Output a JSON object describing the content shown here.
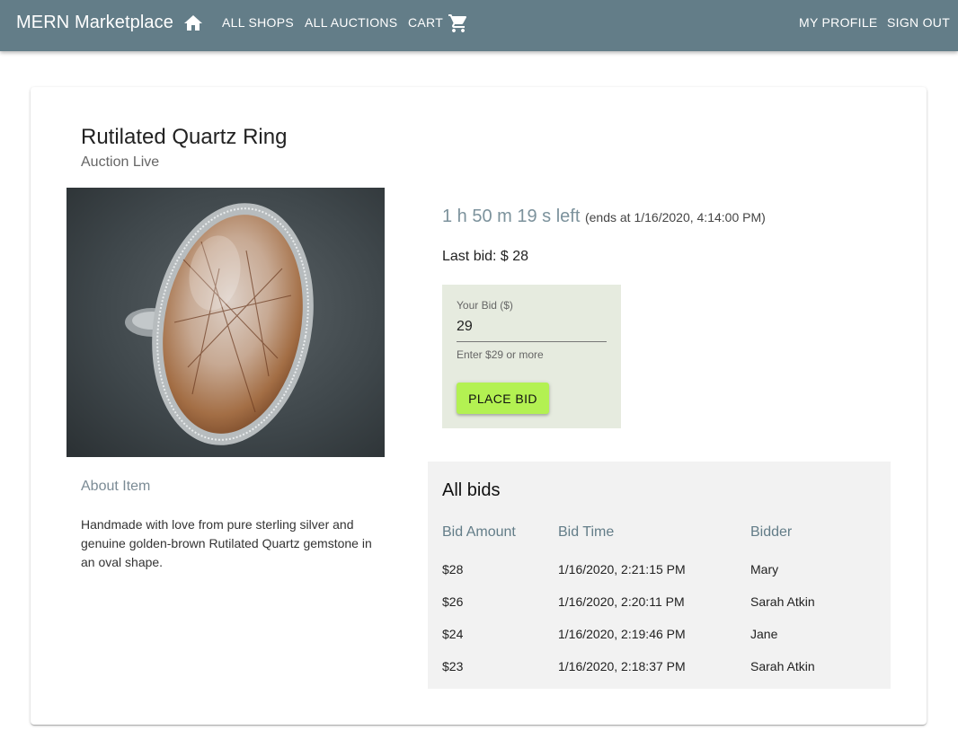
{
  "appbar": {
    "brand": "MERN Marketplace",
    "nav": {
      "all_shops": "ALL SHOPS",
      "all_auctions": "ALL AUCTIONS",
      "cart": "CART",
      "my_profile": "MY PROFILE",
      "sign_out": "SIGN OUT"
    },
    "icons": {
      "home": "home-icon",
      "cart": "shopping-cart-icon"
    },
    "color": "#637d88"
  },
  "auction": {
    "title": "Rutilated Quartz Ring",
    "status": "Auction Live",
    "time_left": "1 h 50 m 19 s left",
    "ends_at": "(ends at 1/16/2020, 4:14:00 PM)",
    "last_bid": "Last bid: $ 28",
    "about_heading": "About Item",
    "about_text": "Handmade with love from pure sterling silver and genuine golden-brown Rutilated Quartz gemstone in an oval shape."
  },
  "bid_form": {
    "label": "Your Bid ($)",
    "value": "29",
    "helper": "Enter $29 or more",
    "button": "PLACE BID",
    "button_color": "#b3f152",
    "panel_color": "#e6ebdf"
  },
  "bids": {
    "heading": "All bids",
    "columns": [
      "Bid Amount",
      "Bid Time",
      "Bidder"
    ],
    "rows": [
      {
        "amount": "$28",
        "time": "1/16/2020, 2:21:15 PM",
        "bidder": "Mary"
      },
      {
        "amount": "$26",
        "time": "1/16/2020, 2:20:11 PM",
        "bidder": "Sarah Atkin"
      },
      {
        "amount": "$24",
        "time": "1/16/2020, 2:19:46 PM",
        "bidder": "Jane"
      },
      {
        "amount": "$23",
        "time": "1/16/2020, 2:18:37 PM",
        "bidder": "Sarah Atkin"
      }
    ]
  }
}
